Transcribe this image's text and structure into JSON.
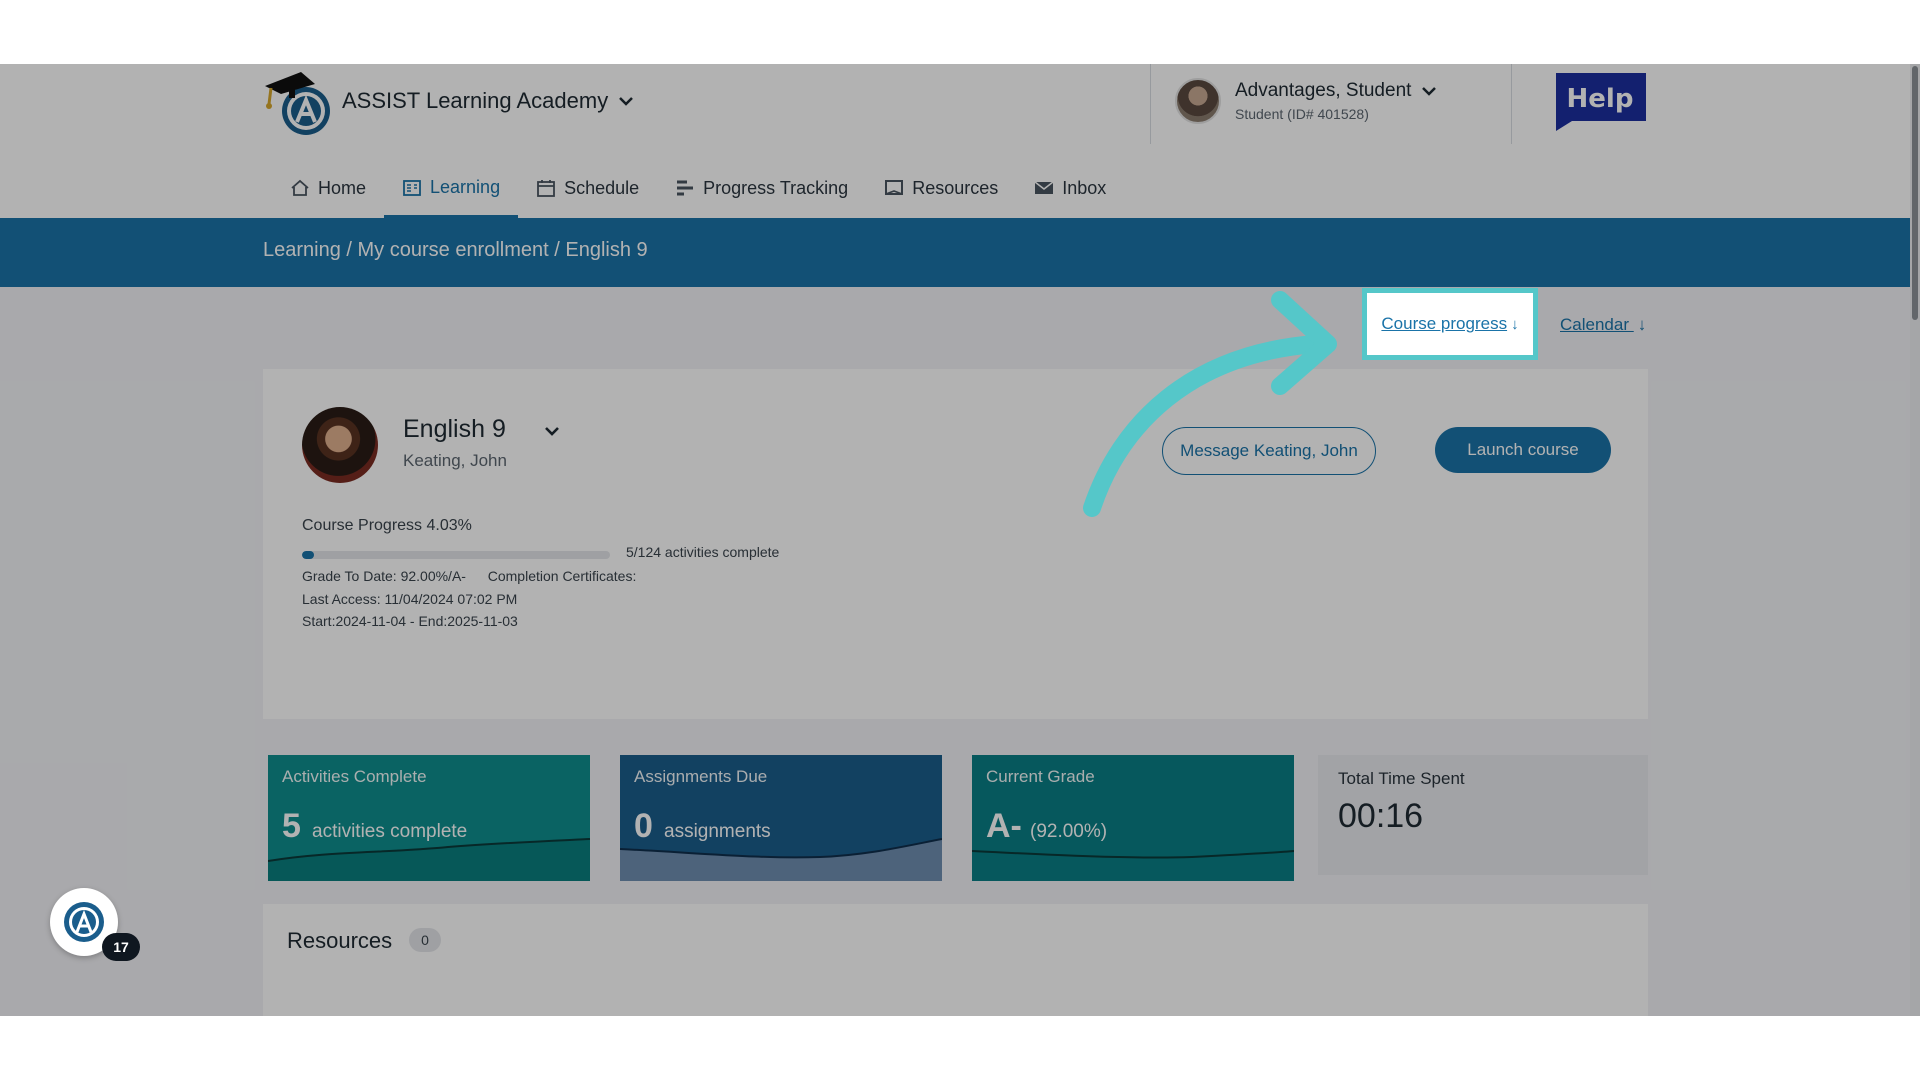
{
  "header": {
    "academy_name": "ASSIST Learning Academy",
    "user_name": "Advantages, Student",
    "user_sub": "Student (ID# 401528)",
    "help_label": "Help"
  },
  "nav": {
    "items": [
      {
        "label": "Home",
        "icon": "home-icon"
      },
      {
        "label": "Learning",
        "icon": "learning-icon",
        "active": true
      },
      {
        "label": "Schedule",
        "icon": "calendar-icon"
      },
      {
        "label": "Progress Tracking",
        "icon": "progress-icon"
      },
      {
        "label": "Resources",
        "icon": "resources-icon"
      },
      {
        "label": "Inbox",
        "icon": "mail-icon"
      }
    ]
  },
  "breadcrumb": "Learning / My course enrollment / English 9",
  "quick_links": {
    "course_progress": "Course progress",
    "calendar": "Calendar"
  },
  "course": {
    "title": "English 9",
    "teacher": "Keating, John",
    "message_button": "Message Keating, John",
    "launch_button": "Launch course",
    "progress_label": "Course Progress 4.03%",
    "progress_fraction": 0.0403,
    "activities_text": "5/124 activities complete",
    "grade_to_date": "Grade To Date: 92.00%/A-",
    "completion_certificates": "Completion Certificates:",
    "last_access": "Last Access: 11/04/2024 07:02 PM",
    "dates": "Start:2024-11-04 - End:2025-11-03"
  },
  "stats": {
    "activities": {
      "label": "Activities Complete",
      "value": "5",
      "unit": "activities complete",
      "color": "#0f8f8f"
    },
    "assignments": {
      "label": "Assignments Due",
      "value": "0",
      "unit": "assignments",
      "color": "#1a5d8c"
    },
    "grade": {
      "label": "Current Grade",
      "value": "A-",
      "unit": "(92.00%)",
      "color": "#0a7f86"
    },
    "time": {
      "label": "Total Time Spent",
      "value": "00:16"
    }
  },
  "resources": {
    "title": "Resources",
    "count": "0"
  },
  "fab": {
    "badge": "17"
  },
  "colors": {
    "accent": "#1a73a8",
    "highlight": "#55c7c9"
  }
}
